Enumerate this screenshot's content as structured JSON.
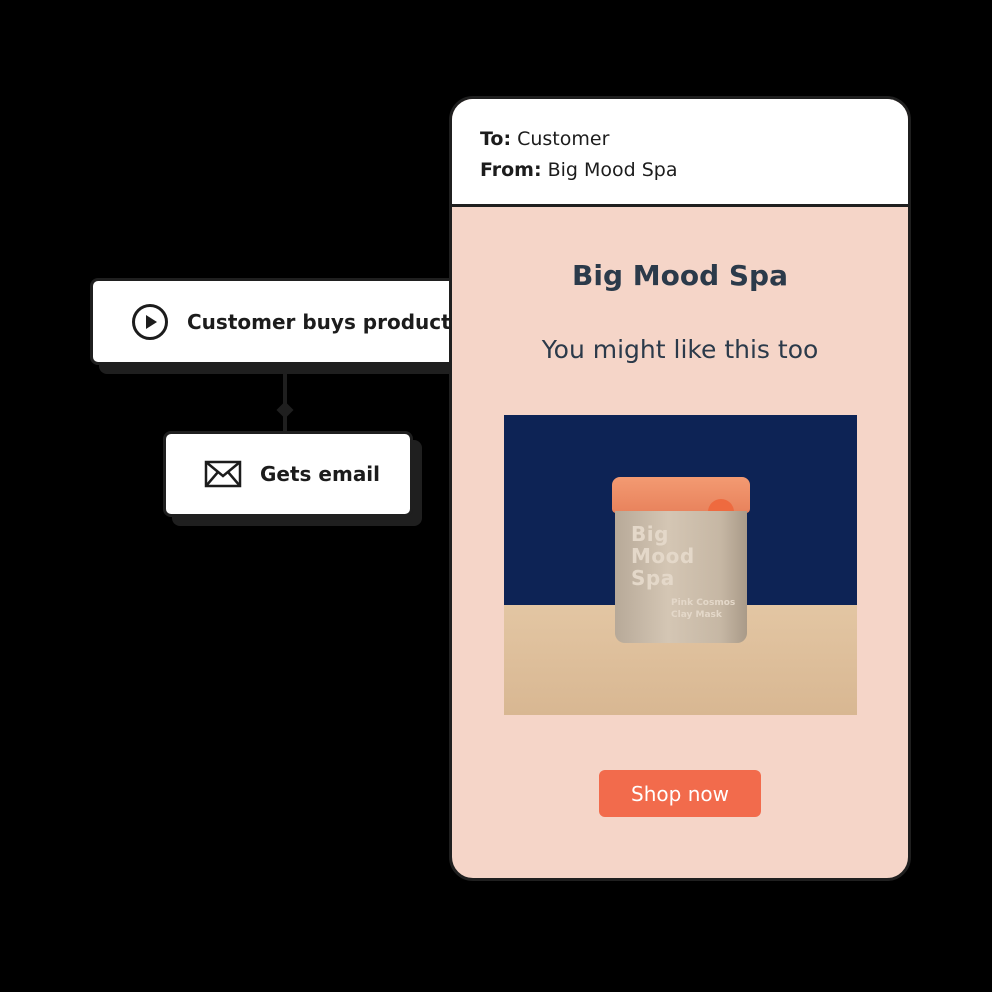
{
  "flow": {
    "trigger": {
      "label": "Customer buys product",
      "icon": "play-circle-icon"
    },
    "action": {
      "label": "Gets email",
      "icon": "envelope-icon"
    }
  },
  "email": {
    "to_label": "To:",
    "to_value": "Customer",
    "from_label": "From:",
    "from_value": "Big Mood Spa",
    "brand_name": "Big Mood Spa",
    "tagline": "You might like this too",
    "product": {
      "jar_text": "Big Mood Spa",
      "jar_subtext": "Pink Cosmos Clay Mask"
    },
    "cta_label": "Shop now"
  },
  "colors": {
    "background": "#000000",
    "card": "#f5d5c8",
    "cta": "#f26b4c",
    "brand_text": "#2b3a4a"
  }
}
